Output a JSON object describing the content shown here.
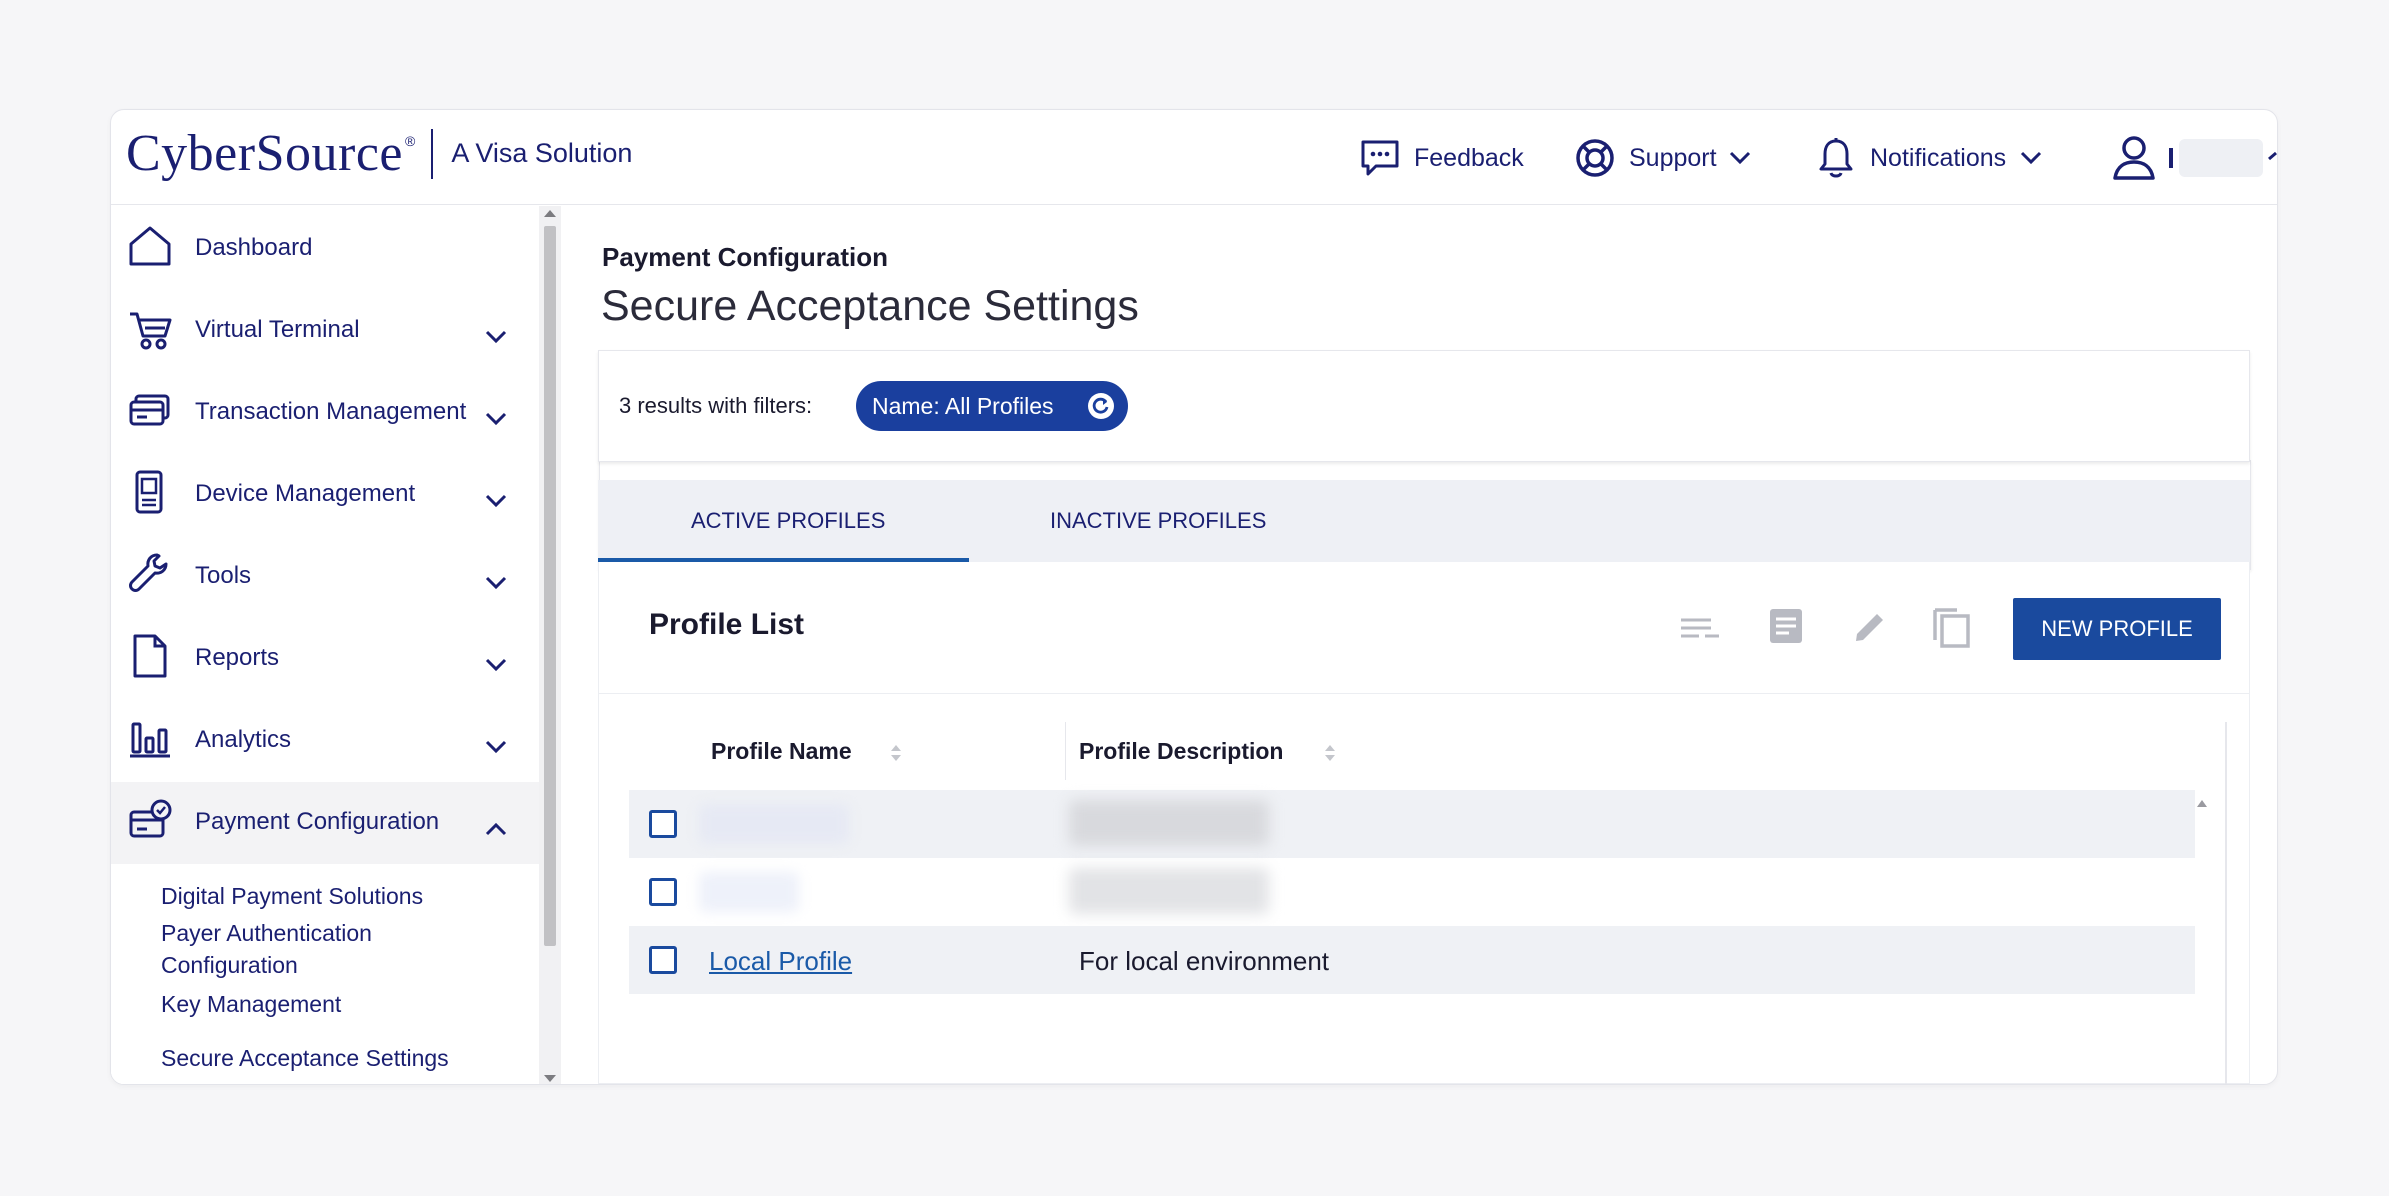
{
  "app": {
    "brand": "CyberSource",
    "brand_mark": "®",
    "tagline": "A Visa Solution"
  },
  "header": {
    "feedback": "Feedback",
    "support": "Support",
    "notifications": "Notifications"
  },
  "sidebar": {
    "items": [
      {
        "label": "Dashboard"
      },
      {
        "label": "Virtual Terminal"
      },
      {
        "label": "Transaction Management"
      },
      {
        "label": "Device Management"
      },
      {
        "label": "Tools"
      },
      {
        "label": "Reports"
      },
      {
        "label": "Analytics"
      },
      {
        "label": "Payment Configuration"
      }
    ],
    "sub_items": [
      "Digital Payment Solutions",
      "Payer Authentication",
      "Configuration",
      "Key Management",
      "Secure Acceptance Settings"
    ]
  },
  "page": {
    "breadcrumb": "Payment Configuration",
    "title": "Secure Acceptance Settings"
  },
  "filters": {
    "summary": "3 results with filters:",
    "chip": "Name: All Profiles"
  },
  "tabs": [
    {
      "label": "ACTIVE PROFILES",
      "active": true
    },
    {
      "label": "INACTIVE PROFILES",
      "active": false
    }
  ],
  "profile_list": {
    "title": "Profile List",
    "new_button": "NEW PROFILE",
    "columns": [
      "Profile Name",
      "Profile Description"
    ],
    "rows": [
      {
        "name": "",
        "description": ""
      },
      {
        "name": "",
        "description": ""
      },
      {
        "name": "Local Profile",
        "description": "For local environment"
      }
    ]
  },
  "colors": {
    "brand_navy": "#1a1f71",
    "primary_button": "#1a4a9e",
    "chip_bg": "#1a3f9e",
    "link": "#1a5aa8"
  }
}
